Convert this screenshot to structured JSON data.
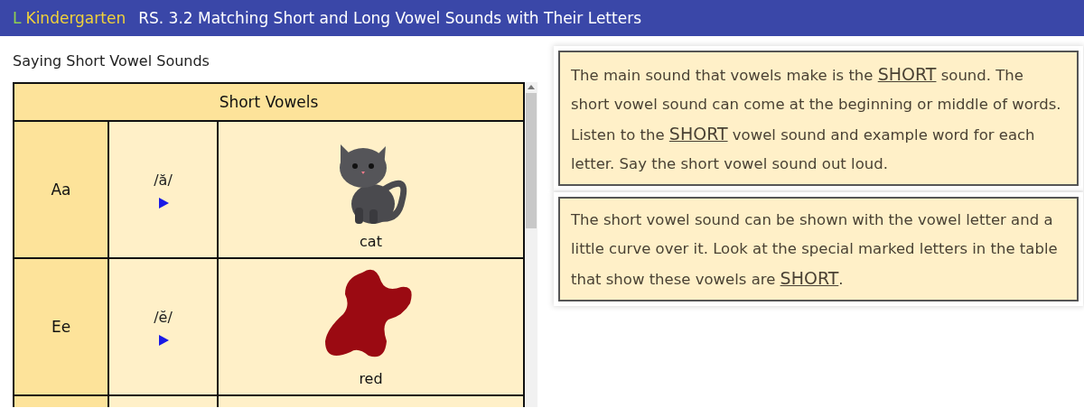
{
  "header": {
    "grade_letter": "L",
    "grade_name": "Kindergarten",
    "lesson_title": "RS. 3.2 Matching Short and Long Vowel Sounds with Their Letters"
  },
  "section_title": "Saying Short Vowel Sounds",
  "table": {
    "title": "Short Vowels",
    "rows": [
      {
        "letters": "Aa",
        "sound": "/ă/",
        "kind": "cat",
        "word": "cat"
      },
      {
        "letters": "Ee",
        "sound": "/ĕ/",
        "kind": "blot",
        "word": "red"
      }
    ]
  },
  "cards": [
    {
      "parts": [
        {
          "kind": "plain",
          "text": "The main sound that vowels make is the "
        },
        {
          "kind": "emphasis",
          "text": "SHORT"
        },
        {
          "kind": "plain",
          "text": " sound. The short vowel sound can come at the beginning or middle of words. Listen to the "
        },
        {
          "kind": "emphasis",
          "text": "SHORT"
        },
        {
          "kind": "plain",
          "text": " vowel sound and example word for each letter. Say the short vowel sound out loud."
        }
      ]
    },
    {
      "parts": [
        {
          "kind": "plain",
          "text": "The short vowel sound can be shown with the vowel letter and a little curve over it. Look at the special marked letters in the table that show these vowels are "
        },
        {
          "kind": "emphasis",
          "text": "SHORT"
        },
        {
          "kind": "plain",
          "text": "."
        }
      ]
    }
  ]
}
